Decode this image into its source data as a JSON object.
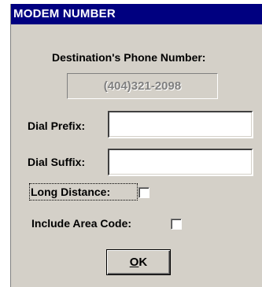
{
  "dialog": {
    "title": "MODEM NUMBER",
    "destination_label": "Destination's Phone Number:",
    "phone_number": "(404)321-2098",
    "dial_prefix_label": "Dial Prefix:",
    "dial_prefix_value": "",
    "dial_suffix_label": "Dial Suffix:",
    "dial_suffix_value": "",
    "long_distance_label": "Long Distance:",
    "long_distance_checked": false,
    "include_area_code_label": "Include Area Code:",
    "include_area_code_checked": false,
    "ok_accel": "O",
    "ok_rest": "K"
  },
  "colors": {
    "titlebar": "#000080",
    "face": "#d4d0c8",
    "disabled_text": "#808080"
  }
}
